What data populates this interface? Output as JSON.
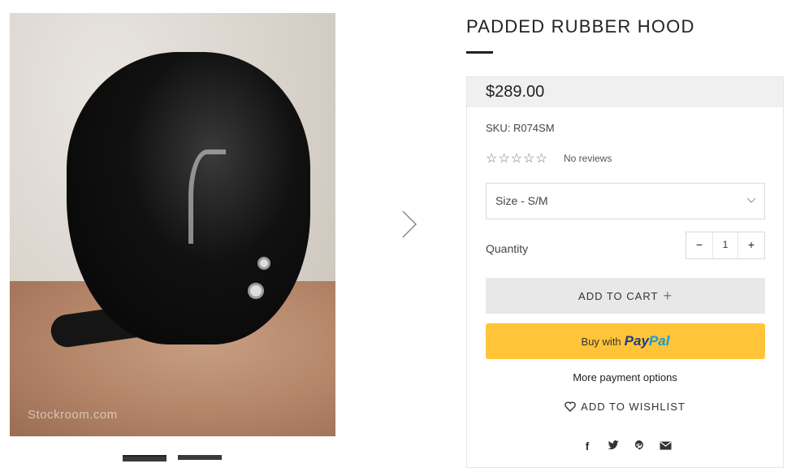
{
  "gallery": {
    "watermark": "Stockroom.com",
    "next_icon": "chevron-right-icon"
  },
  "product": {
    "title": "PADDED RUBBER HOOD",
    "price": "$289.00",
    "sku": "SKU: R074SM",
    "rating": {
      "stars": "☆☆☆☆☆",
      "reviews_text": "No reviews"
    },
    "size_select": {
      "label": "Size  -  S/M"
    },
    "quantity": {
      "label": "Quantity",
      "value": "1",
      "minus": "−",
      "plus": "+"
    },
    "add_to_cart": {
      "label": "ADD TO CART",
      "icon": "+"
    },
    "paypal": {
      "prefix": "Buy with",
      "brand_pay": "Pay",
      "brand_pal": "Pal"
    },
    "more_payment": "More payment options",
    "wishlist": "ADD TO WISHLIST"
  },
  "social": {
    "facebook": "f",
    "icons": [
      "facebook-icon",
      "twitter-icon",
      "pinterest-icon",
      "email-icon"
    ]
  },
  "colors": {
    "paypal_yellow": "#ffc438",
    "paypal_dark_blue": "#253b80",
    "paypal_light_blue": "#179bd7",
    "cart_button": "#e8e8e8",
    "price_bar": "#f0f0f0"
  }
}
